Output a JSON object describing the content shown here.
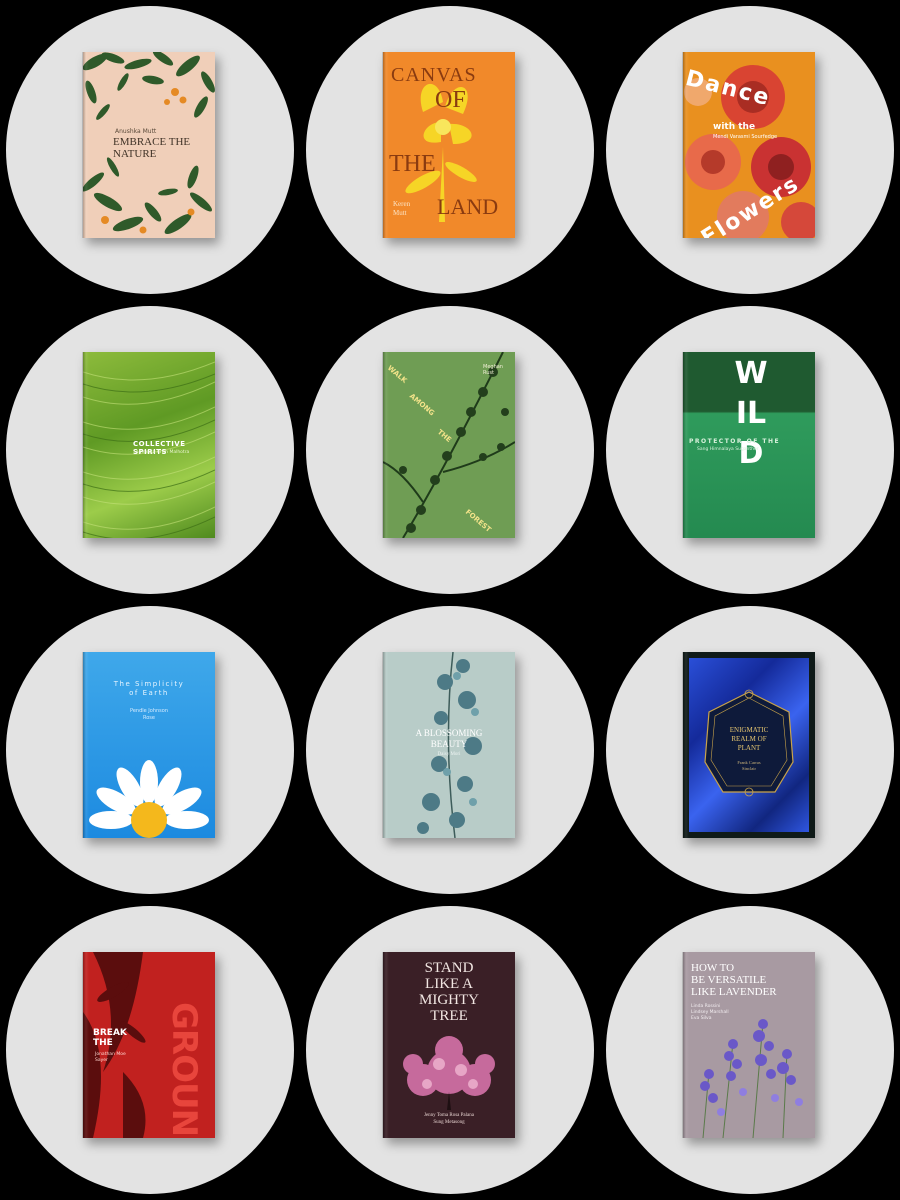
{
  "books": [
    {
      "author": "Anushka Mutt",
      "title": "EMBRACE THE NATURE"
    },
    {
      "title_lines": [
        "CANVAS",
        "OF",
        "THE",
        "LAND"
      ],
      "author_lines": [
        "Keren",
        "Mutt"
      ]
    },
    {
      "title_top": "Dance",
      "title_mid": "with the",
      "subtitle": "Mendi Varasmi Sourfedge",
      "title_bottom": "Flowers"
    },
    {
      "title": "COLLECTIVE SPIRITS",
      "author": "Sameeiya Arish Malhotra"
    },
    {
      "title_words": [
        "WALK",
        "AMONG",
        "THE",
        "FOREST"
      ],
      "author": "Meghan Rust"
    },
    {
      "title": "WILD",
      "subtitle": "PROTECTOR OF THE",
      "author": "Sang Himnalaya Suganther"
    },
    {
      "title_lines": [
        "The Simplicity",
        "of Earth"
      ],
      "author_lines": [
        "Pendle Johnson",
        "Rose"
      ]
    },
    {
      "title_lines": [
        "A BLOSSOMING",
        "BEAUTY"
      ],
      "author": "Daisy Mori"
    },
    {
      "title_lines": [
        "ENIGMATIC",
        "REALM OF",
        "PLANT"
      ],
      "author_lines": [
        "Frank Carras",
        "Sinclair"
      ]
    },
    {
      "title_top_lines": [
        "BREAK",
        "THE"
      ],
      "title_big": "GROUND",
      "author_lines": [
        "Jonathan Moe",
        "Sayer"
      ]
    },
    {
      "title_lines": [
        "STAND",
        "LIKE A",
        "MIGHTY",
        "TREE"
      ],
      "author_lines": [
        "Jenny Toma Rosa Palana",
        "Sung Metasong"
      ]
    },
    {
      "title_lines": [
        "HOW TO",
        "BE VERSATILE",
        "LIKE LAVENDER"
      ],
      "author_lines": [
        "Linda Rossini",
        "Lindsey Marshall",
        "Eva Silva"
      ]
    }
  ],
  "colors": {
    "page_bg": "#000000",
    "circle_bg": "#e3e3e3"
  }
}
